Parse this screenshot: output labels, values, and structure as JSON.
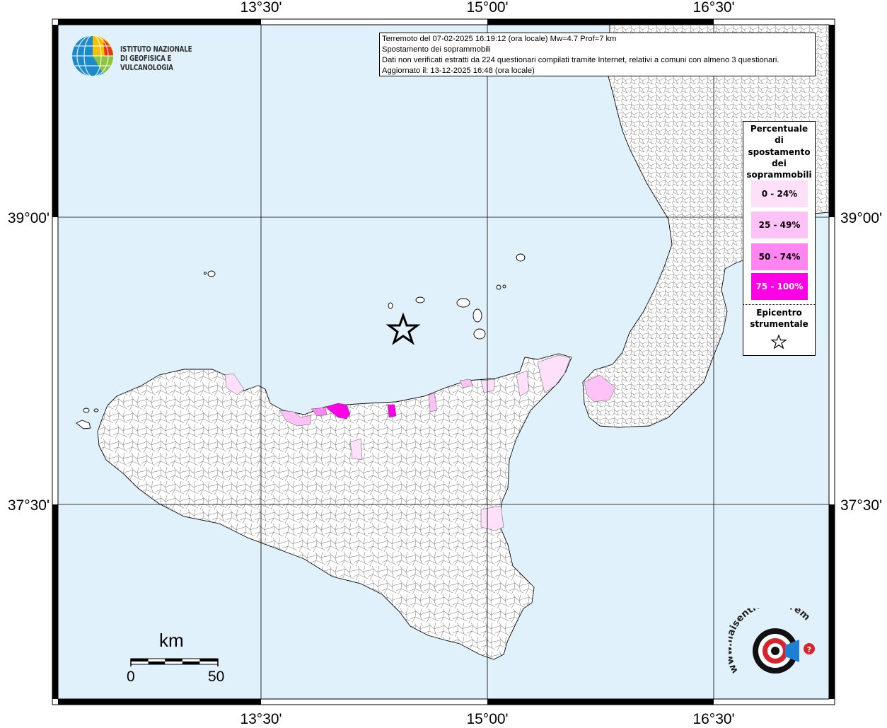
{
  "map": {
    "latitude_labels": [
      "39°00'",
      "37°30'"
    ],
    "longitude_labels": [
      "13°30'",
      "15°00'",
      "16°30'"
    ],
    "colors": {
      "sea": "#e0f1fc",
      "land": "#ffffff",
      "border": "#000000",
      "grid": "#000000",
      "class_0_24": "#ffe0fb",
      "class_25_49": "#ffc2f7",
      "class_50_74": "#ff85f0",
      "class_75_100": "#ff00e6"
    }
  },
  "logo": {
    "line1": "ISTITUTO NAZIONALE",
    "line2": "DI GEOFISICA E VULCANOLOGIA"
  },
  "info": {
    "line1": "Terremoto del 07-02-2025 16:19:12 (ora locale) Mw=4.7 Prof=7 km",
    "line2": "Spostamento dei soprammobili",
    "line3": "Dati non verificati estratti da 224 questionari compilati tramite Internet, relativi a comuni con almeno 3 questionari.",
    "line4": "Aggiornato il: 13-12-2025 16:48 (ora locale)"
  },
  "legend": {
    "title_lines": [
      "Percentuale",
      "di",
      "spostamento",
      "dei",
      "soprammobili"
    ],
    "items": [
      {
        "label": "0 - 24%",
        "color": "#ffe0fb",
        "text_color": "#000000"
      },
      {
        "label": "25 - 49%",
        "color": "#ffc2f7",
        "text_color": "#000000"
      },
      {
        "label": "50 - 74%",
        "color": "#ff85f0",
        "text_color": "#000000"
      },
      {
        "label": "75 - 100%",
        "color": "#ff00e6",
        "text_color": "#ffffff"
      }
    ],
    "epicenter_line1": "Epicentro",
    "epicenter_line2": "strumentale"
  },
  "scale": {
    "unit": "km",
    "start": "0",
    "end": "50"
  },
  "brand": {
    "text": "www.haisentitoilterremoto.it",
    "icon": "question-mark-icon"
  }
}
